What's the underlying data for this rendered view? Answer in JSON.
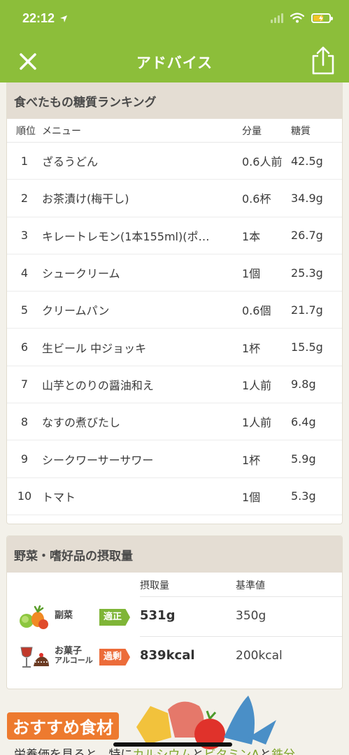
{
  "status_bar": {
    "time": "22:12"
  },
  "nav": {
    "title": "アドバイス"
  },
  "ranking": {
    "title": "食べたもの糖質ランキング",
    "headers": {
      "rank": "順位",
      "menu": "メニュー",
      "amount": "分量",
      "carb": "糖質"
    },
    "rows": [
      {
        "rank": "1",
        "menu": "ざるうどん",
        "amount": "0.6人前",
        "carb": "42.5g"
      },
      {
        "rank": "2",
        "menu": "お茶漬け(梅干し)",
        "amount": "0.6杯",
        "carb": "34.9g"
      },
      {
        "rank": "3",
        "menu": "キレートレモン(1本155ml)(ポ…",
        "amount": "1本",
        "carb": "26.7g"
      },
      {
        "rank": "4",
        "menu": "シュークリーム",
        "amount": "1個",
        "carb": "25.3g"
      },
      {
        "rank": "5",
        "menu": "クリームパン",
        "amount": "0.6個",
        "carb": "21.7g"
      },
      {
        "rank": "6",
        "menu": "生ビール 中ジョッキ",
        "amount": "1杯",
        "carb": "15.5g"
      },
      {
        "rank": "7",
        "menu": "山芋とのりの醤油和え",
        "amount": "1人前",
        "carb": "9.8g"
      },
      {
        "rank": "8",
        "menu": "なすの煮びたし",
        "amount": "1人前",
        "carb": "6.4g"
      },
      {
        "rank": "9",
        "menu": "シークワーサーサワー",
        "amount": "1杯",
        "carb": "5.9g"
      },
      {
        "rank": "10",
        "menu": "トマト",
        "amount": "1個",
        "carb": "5.3g"
      }
    ]
  },
  "intake": {
    "title": "野菜・嗜好品の摂取量",
    "headers": {
      "intake": "摂取量",
      "standard": "基準値"
    },
    "rows": [
      {
        "label": "副菜",
        "icon": "vegetables-icon",
        "badge": "適正",
        "badge_color": "#7fb537",
        "value": "531g",
        "standard": "350g"
      },
      {
        "label_line1": "お菓子",
        "label_line2": "アルコール",
        "icon": "snacks-alcohol-icon",
        "badge": "過剰",
        "badge_color": "#ec6c3a",
        "value": "839kcal",
        "standard": "200kcal"
      }
    ]
  },
  "recommend": {
    "title": "おすすめ食材",
    "text_prefix": "栄養価を見ると、特に",
    "highlight1": "カルシウム",
    "text_mid1": "と",
    "highlight2": "ビタミンA",
    "text_mid2": "と",
    "highlight3": "鉄分"
  },
  "colors": {
    "brand": "#8cbe3a",
    "ok": "#7fb537",
    "over": "#ec6c3a",
    "accent": "#ed7a2f"
  }
}
